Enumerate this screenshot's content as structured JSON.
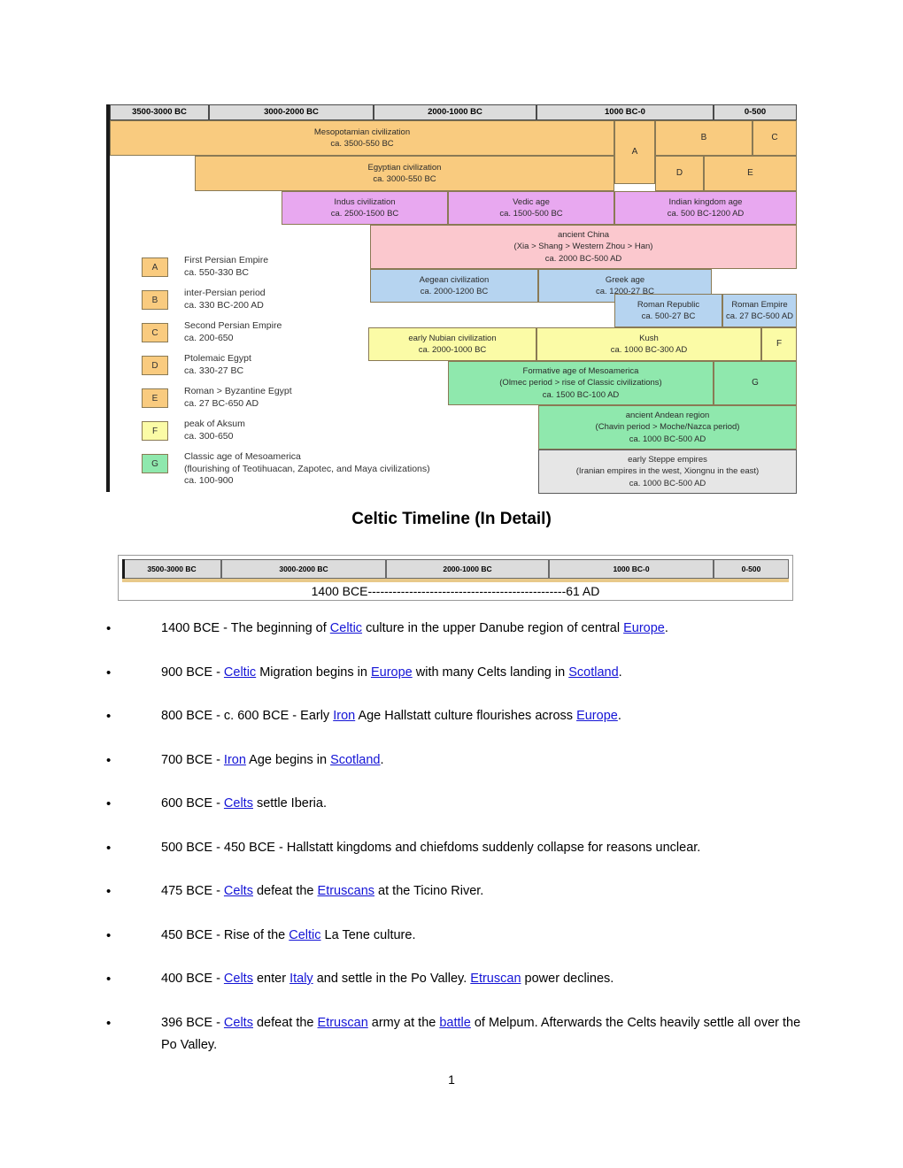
{
  "figure": {
    "columns": [
      {
        "label": "3500-3000 BC"
      },
      {
        "label": "3000-2000 BC"
      },
      {
        "label": "2000-1000 BC"
      },
      {
        "label": "1000 BC-0"
      },
      {
        "label": "0-500"
      }
    ],
    "bands": [
      {
        "name": "mesopotamian",
        "title": "Mesopotamian civilization",
        "dates": "ca. 3500-550 BC",
        "color": "#f9cb7f"
      },
      {
        "name": "egyptian",
        "title": "Egyptian civilization",
        "dates": "ca. 3000-550 BC",
        "color": "#f9cb7f"
      },
      {
        "name": "persian-a",
        "title": "A",
        "dates": "",
        "color": "#f9cb7f"
      },
      {
        "name": "persian-b",
        "title": "B",
        "dates": "",
        "color": "#f9cb7f"
      },
      {
        "name": "persian-c",
        "title": "C",
        "dates": "",
        "color": "#f9cb7f"
      },
      {
        "name": "egypt-d",
        "title": "D",
        "dates": "",
        "color": "#f9cb7f"
      },
      {
        "name": "egypt-e",
        "title": "E",
        "dates": "",
        "color": "#f9cb7f"
      },
      {
        "name": "indus",
        "title": "Indus civilization",
        "dates": "ca. 2500-1500 BC",
        "color": "#e8a8f0"
      },
      {
        "name": "vedic",
        "title": "Vedic age",
        "dates": "ca. 1500-500 BC",
        "color": "#e8a8f0"
      },
      {
        "name": "indian-kingdom",
        "title": "Indian kingdom age",
        "dates": "ca. 500 BC-1200 AD",
        "color": "#e8a8f0"
      },
      {
        "name": "ancient-china",
        "title": "ancient China",
        "sub": "(Xia > Shang > Western Zhou > Han)",
        "dates": "ca. 2000 BC-500 AD",
        "color": "#fbc8ce"
      },
      {
        "name": "aegean",
        "title": "Aegean civilization",
        "dates": "ca. 2000-1200 BC",
        "color": "#b6d4f0"
      },
      {
        "name": "greek-age",
        "title": "Greek age",
        "dates": "ca. 1200-27 BC",
        "color": "#b6d4f0"
      },
      {
        "name": "roman-republic",
        "title": "Roman Republic",
        "dates": "ca. 500-27 BC",
        "color": "#b6d4f0"
      },
      {
        "name": "roman-empire",
        "title": "Roman Empire",
        "dates": "ca. 27 BC-500 AD",
        "color": "#b6d4f0"
      },
      {
        "name": "nubian",
        "title": "early Nubian civilization",
        "dates": "ca. 2000-1000 BC",
        "color": "#fbfba6"
      },
      {
        "name": "kush",
        "title": "Kush",
        "dates": "ca. 1000 BC-300 AD",
        "color": "#fbfba6"
      },
      {
        "name": "aksum-f",
        "title": "F",
        "dates": "",
        "color": "#fbfba6"
      },
      {
        "name": "mesoamerica-formative",
        "title": "Formative age of Mesoamerica",
        "sub": "(Olmec period > rise of Classic civilizations)",
        "dates": "ca. 1500 BC-100 AD",
        "color": "#8fe8ad"
      },
      {
        "name": "mesoamerica-g",
        "title": "G",
        "dates": "",
        "color": "#8fe8ad"
      },
      {
        "name": "andean",
        "title": "ancient Andean region",
        "sub": "(Chavin period > Moche/Nazca period)",
        "dates": "ca. 1000 BC-500 AD",
        "color": "#8fe8ad"
      },
      {
        "name": "steppe",
        "title": "early Steppe empires",
        "sub": "(Iranian empires in the west, Xiongnu in the east)",
        "dates": "ca. 1000 BC-500 AD",
        "color": "#e6e6e6"
      }
    ],
    "legend": [
      {
        "key": "A",
        "color": "#f9cb7f",
        "line1": "First Persian Empire",
        "line2": "ca. 550-330 BC",
        "line3": ""
      },
      {
        "key": "B",
        "color": "#f9cb7f",
        "line1": "inter-Persian period",
        "line2": "ca. 330 BC-200 AD",
        "line3": ""
      },
      {
        "key": "C",
        "color": "#f9cb7f",
        "line1": "Second Persian Empire",
        "line2": "ca. 200-650",
        "line3": ""
      },
      {
        "key": "D",
        "color": "#f9cb7f",
        "line1": "Ptolemaic Egypt",
        "line2": "ca. 330-27 BC",
        "line3": ""
      },
      {
        "key": "E",
        "color": "#f9cb7f",
        "line1": "Roman > Byzantine Egypt",
        "line2": "ca. 27 BC-650 AD",
        "line3": ""
      },
      {
        "key": "F",
        "color": "#fbfba6",
        "line1": "peak of Aksum",
        "line2": "ca. 300-650",
        "line3": ""
      },
      {
        "key": "G",
        "color": "#8fe8ad",
        "line1": "Classic age of Mesoamerica",
        "line2": "(flourishing of Teotihuacan, Zapotec, and Maya civilizations)",
        "line3": "ca. 100-900"
      }
    ]
  },
  "heading": "Celtic Timeline (In Detail)",
  "mini_table": {
    "columns": [
      "3500-3000 BC",
      "3000-2000 BC",
      "2000-1000 BC",
      "1000 BC-0",
      "0-500"
    ],
    "span_start": "1400 BCE",
    "span_dashes": "------------------------------------------------",
    "span_end": "61 AD"
  },
  "bullets": [
    {
      "name": "bullet-1400-bce",
      "parts": [
        {
          "t": "1400 BCE - The beginning of ",
          "link": false
        },
        {
          "t": "Celtic",
          "link": true
        },
        {
          "t": " culture in the upper Danube region of central ",
          "link": false
        },
        {
          "t": "Europe",
          "link": true
        },
        {
          "t": ".",
          "link": false
        }
      ]
    },
    {
      "name": "bullet-900-bce",
      "parts": [
        {
          "t": "900 BCE - ",
          "link": false
        },
        {
          "t": "Celtic",
          "link": true
        },
        {
          "t": " Migration begins in ",
          "link": false
        },
        {
          "t": "Europe",
          "link": true
        },
        {
          "t": " with many Celts landing in ",
          "link": false
        },
        {
          "t": "Scotland",
          "link": true
        },
        {
          "t": ".",
          "link": false
        }
      ]
    },
    {
      "name": "bullet-800-bce",
      "parts": [
        {
          "t": "800 BCE - c. 600 BCE - Early ",
          "link": false
        },
        {
          "t": "Iron",
          "link": true
        },
        {
          "t": " Age Hallstatt culture flourishes across ",
          "link": false
        },
        {
          "t": "Europe",
          "link": true
        },
        {
          "t": ".",
          "link": false
        }
      ]
    },
    {
      "name": "bullet-700-bce",
      "parts": [
        {
          "t": "700 BCE - ",
          "link": false
        },
        {
          "t": "Iron",
          "link": true
        },
        {
          "t": " Age begins in ",
          "link": false
        },
        {
          "t": "Scotland",
          "link": true
        },
        {
          "t": ".",
          "link": false
        }
      ]
    },
    {
      "name": "bullet-600-bce",
      "parts": [
        {
          "t": "600 BCE - ",
          "link": false
        },
        {
          "t": "Celts",
          "link": true
        },
        {
          "t": " settle Iberia.",
          "link": false
        }
      ]
    },
    {
      "name": "bullet-500-bce",
      "parts": [
        {
          "t": "500 BCE - 450 BCE - Hallstatt kingdoms and chiefdoms suddenly collapse for reasons unclear.",
          "link": false
        }
      ]
    },
    {
      "name": "bullet-475-bce",
      "parts": [
        {
          "t": "475 BCE - ",
          "link": false
        },
        {
          "t": "Celts",
          "link": true
        },
        {
          "t": " defeat the ",
          "link": false
        },
        {
          "t": "Etruscans",
          "link": true
        },
        {
          "t": " at the Ticino River.",
          "link": false
        }
      ]
    },
    {
      "name": "bullet-450-bce",
      "parts": [
        {
          "t": "450 BCE - Rise of the ",
          "link": false
        },
        {
          "t": "Celtic",
          "link": true
        },
        {
          "t": " La Tene culture.",
          "link": false
        }
      ]
    },
    {
      "name": "bullet-400-bce",
      "parts": [
        {
          "t": "400 BCE - ",
          "link": false
        },
        {
          "t": "Celts",
          "link": true
        },
        {
          "t": " enter ",
          "link": false
        },
        {
          "t": "Italy",
          "link": true
        },
        {
          "t": " and settle in the Po Valley. ",
          "link": false
        },
        {
          "t": "Etruscan",
          "link": true
        },
        {
          "t": " power declines.",
          "link": false
        }
      ]
    },
    {
      "name": "bullet-396-bce",
      "parts": [
        {
          "t": "396 BCE - ",
          "link": false
        },
        {
          "t": "Celts",
          "link": true
        },
        {
          "t": " defeat the ",
          "link": false
        },
        {
          "t": "Etruscan",
          "link": true
        },
        {
          "t": " army at the ",
          "link": false
        },
        {
          "t": "battle",
          "link": true
        },
        {
          "t": " of Melpum. Afterwards the Celts heavily settle all over the Po Valley.",
          "link": false
        }
      ]
    }
  ],
  "page_number": "1"
}
